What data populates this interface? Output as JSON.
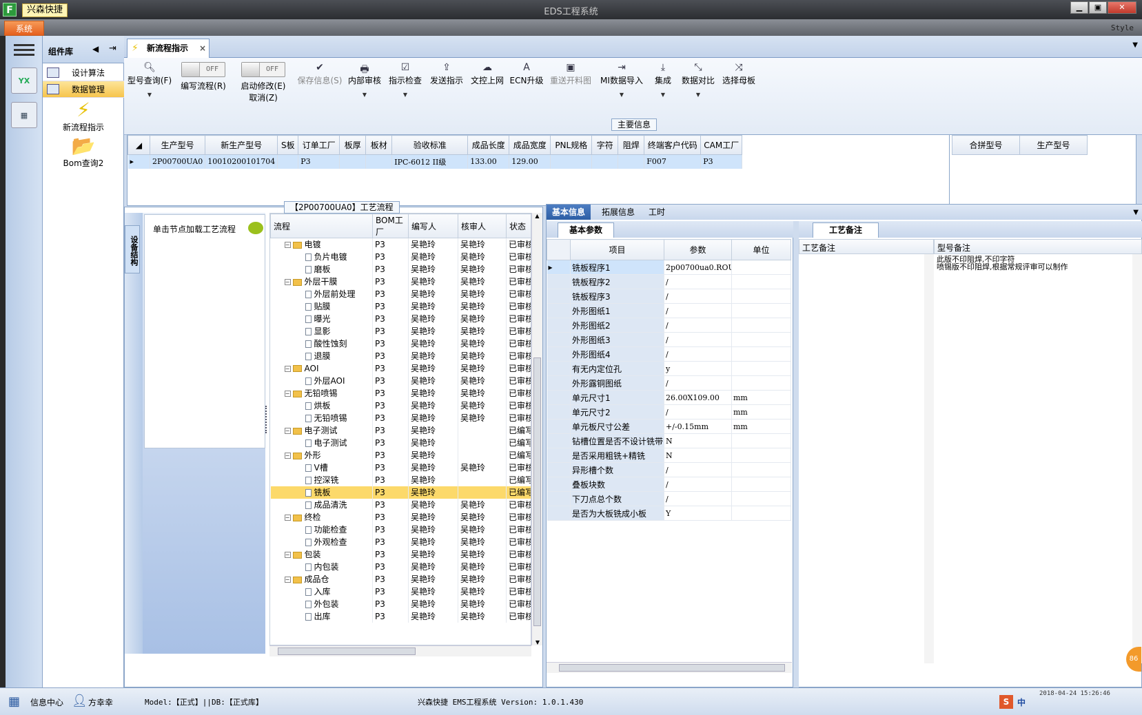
{
  "window": {
    "app_tag": "兴森快捷",
    "title": "EDS工程系统",
    "app_icon": "F"
  },
  "menu": {
    "system_label": "系统",
    "style_label": "Style"
  },
  "icon_bar": {
    "yx_label": "YX"
  },
  "component_library": {
    "title": "组件库",
    "items": [
      {
        "label": "设计算法",
        "selected": false
      },
      {
        "label": "数据管理",
        "selected": true
      }
    ],
    "tools": [
      {
        "label": "新流程指示",
        "icon": "lightning-icon"
      },
      {
        "label": "Bom查询2",
        "icon": "folder-open-icon"
      }
    ]
  },
  "doc_tab": {
    "label": "新流程指示",
    "close": "×"
  },
  "ribbon": {
    "query": {
      "label": "型号查询(F)"
    },
    "edit_flow": {
      "label": "编写流程(R)",
      "toggle": "OFF"
    },
    "start_modify": {
      "label": "启动修改(E)",
      "label2": "取消(Z)",
      "toggle": "OFF"
    },
    "buttons": [
      {
        "label": "保存信息(S)",
        "icon": "✔",
        "disabled": true,
        "dropdown": false
      },
      {
        "label": "内部审核",
        "icon": "🖶",
        "disabled": false,
        "dropdown": true
      },
      {
        "label": "指示检查",
        "icon": "☑",
        "disabled": false,
        "dropdown": true
      },
      {
        "label": "发送指示",
        "icon": "⇪",
        "disabled": false,
        "dropdown": false
      },
      {
        "label": "文控上网",
        "icon": "☁",
        "disabled": false,
        "dropdown": false
      },
      {
        "label": "ECN升级",
        "icon": "A",
        "disabled": false,
        "dropdown": false
      },
      {
        "label": "重送开料图",
        "icon": "▣",
        "disabled": true,
        "dropdown": false
      },
      {
        "label": "MI数据导入",
        "icon": "⇥",
        "disabled": false,
        "dropdown": true
      },
      {
        "label": "集成",
        "icon": "⤓",
        "disabled": false,
        "dropdown": true
      },
      {
        "label": "数据对比",
        "icon": "⤡",
        "disabled": false,
        "dropdown": true
      },
      {
        "label": "选择母板",
        "icon": "⤨",
        "disabled": false,
        "dropdown": false
      }
    ]
  },
  "main_info": {
    "label": "主要信息",
    "columns": [
      "生产型号",
      "新生产型号",
      "S板",
      "订单工厂",
      "板厚",
      "板材",
      "验收标准",
      "成品长度",
      "成品宽度",
      "PNL规格",
      "字符",
      "阻焊",
      "终端客户代码",
      "CAM工厂"
    ],
    "rows": [
      [
        "2P00700UA0",
        "10010200101704",
        "",
        "P3",
        "",
        "",
        "IPC-6012 II级",
        "133.00",
        "129.00",
        "",
        "",
        "",
        "F007",
        "P3"
      ]
    ],
    "side_columns": [
      "合拼型号",
      "生产型号"
    ]
  },
  "flow_panel": {
    "title": "【2P00700UA0】工艺流程",
    "side_tab": "设备结构",
    "hint": "单击节点加载工艺流程",
    "columns": [
      "流程",
      "BOM工厂",
      "编写人",
      "核审人",
      "状态"
    ],
    "rows": [
      {
        "name": "电镀",
        "type": "folder",
        "factory": "P3",
        "writer": "吴艳玲",
        "checker": "吴艳玲",
        "status": "已审核"
      },
      {
        "name": "负片电镀",
        "type": "leaf",
        "factory": "P3",
        "writer": "吴艳玲",
        "checker": "吴艳玲",
        "status": "已审核"
      },
      {
        "name": "磨板",
        "type": "leaf",
        "factory": "P3",
        "writer": "吴艳玲",
        "checker": "吴艳玲",
        "status": "已审核"
      },
      {
        "name": "外层干膜",
        "type": "folder",
        "factory": "P3",
        "writer": "吴艳玲",
        "checker": "吴艳玲",
        "status": "已审核"
      },
      {
        "name": "外层前处理",
        "type": "leaf",
        "factory": "P3",
        "writer": "吴艳玲",
        "checker": "吴艳玲",
        "status": "已审核"
      },
      {
        "name": "贴膜",
        "type": "leaf",
        "factory": "P3",
        "writer": "吴艳玲",
        "checker": "吴艳玲",
        "status": "已审核"
      },
      {
        "name": "曝光",
        "type": "leaf",
        "factory": "P3",
        "writer": "吴艳玲",
        "checker": "吴艳玲",
        "status": "已审核"
      },
      {
        "name": "显影",
        "type": "leaf",
        "factory": "P3",
        "writer": "吴艳玲",
        "checker": "吴艳玲",
        "status": "已审核"
      },
      {
        "name": "酸性蚀刻",
        "type": "leaf",
        "factory": "P3",
        "writer": "吴艳玲",
        "checker": "吴艳玲",
        "status": "已审核"
      },
      {
        "name": "退膜",
        "type": "leaf",
        "factory": "P3",
        "writer": "吴艳玲",
        "checker": "吴艳玲",
        "status": "已审核"
      },
      {
        "name": "AOI",
        "type": "folder",
        "factory": "P3",
        "writer": "吴艳玲",
        "checker": "吴艳玲",
        "status": "已审核"
      },
      {
        "name": "外层AOI",
        "type": "leaf",
        "factory": "P3",
        "writer": "吴艳玲",
        "checker": "吴艳玲",
        "status": "已审核"
      },
      {
        "name": "无铅喷锡",
        "type": "folder",
        "factory": "P3",
        "writer": "吴艳玲",
        "checker": "吴艳玲",
        "status": "已审核"
      },
      {
        "name": "烘板",
        "type": "leaf",
        "factory": "P3",
        "writer": "吴艳玲",
        "checker": "吴艳玲",
        "status": "已审核"
      },
      {
        "name": "无铅喷锡",
        "type": "leaf",
        "factory": "P3",
        "writer": "吴艳玲",
        "checker": "吴艳玲",
        "status": "已审核"
      },
      {
        "name": "电子测试",
        "type": "folder",
        "factory": "P3",
        "writer": "吴艳玲",
        "checker": "",
        "status": "已编写"
      },
      {
        "name": "电子测试",
        "type": "leaf",
        "factory": "P3",
        "writer": "吴艳玲",
        "checker": "",
        "status": "已编写"
      },
      {
        "name": "外形",
        "type": "folder",
        "factory": "P3",
        "writer": "吴艳玲",
        "checker": "",
        "status": "已编写"
      },
      {
        "name": "V槽",
        "type": "leaf",
        "factory": "P3",
        "writer": "吴艳玲",
        "checker": "吴艳玲",
        "status": "已审核"
      },
      {
        "name": "控深铣",
        "type": "leaf",
        "factory": "P3",
        "writer": "吴艳玲",
        "checker": "",
        "status": "已编写"
      },
      {
        "name": "铣板",
        "type": "leaf",
        "factory": "P3",
        "writer": "吴艳玲",
        "checker": "",
        "status": "已编写",
        "highlight": true
      },
      {
        "name": "成品清洗",
        "type": "leaf",
        "factory": "P3",
        "writer": "吴艳玲",
        "checker": "吴艳玲",
        "status": "已审核"
      },
      {
        "name": "终检",
        "type": "folder",
        "factory": "P3",
        "writer": "吴艳玲",
        "checker": "吴艳玲",
        "status": "已审核"
      },
      {
        "name": "功能检查",
        "type": "leaf",
        "factory": "P3",
        "writer": "吴艳玲",
        "checker": "吴艳玲",
        "status": "已审核"
      },
      {
        "name": "外观检查",
        "type": "leaf",
        "factory": "P3",
        "writer": "吴艳玲",
        "checker": "吴艳玲",
        "status": "已审核"
      },
      {
        "name": "包装",
        "type": "folder",
        "factory": "P3",
        "writer": "吴艳玲",
        "checker": "吴艳玲",
        "status": "已审核"
      },
      {
        "name": "内包装",
        "type": "leaf",
        "factory": "P3",
        "writer": "吴艳玲",
        "checker": "吴艳玲",
        "status": "已审核"
      },
      {
        "name": "成品仓",
        "type": "folder",
        "factory": "P3",
        "writer": "吴艳玲",
        "checker": "吴艳玲",
        "status": "已审核"
      },
      {
        "name": "入库",
        "type": "leaf",
        "factory": "P3",
        "writer": "吴艳玲",
        "checker": "吴艳玲",
        "status": "已审核"
      },
      {
        "name": "外包装",
        "type": "leaf",
        "factory": "P3",
        "writer": "吴艳玲",
        "checker": "吴艳玲",
        "status": "已审核"
      },
      {
        "name": "出库",
        "type": "leaf",
        "factory": "P3",
        "writer": "吴艳玲",
        "checker": "吴艳玲",
        "status": "已审核"
      }
    ]
  },
  "detail_tabs": [
    "基本信息",
    "拓展信息",
    "工时"
  ],
  "basic_params": {
    "title": "基本参数",
    "columns": [
      "项目",
      "参数",
      "单位"
    ],
    "rows": [
      {
        "item": "铣板程序1",
        "value": "2p00700ua0.ROU",
        "unit": ""
      },
      {
        "item": "铣板程序2",
        "value": "/",
        "unit": ""
      },
      {
        "item": "铣板程序3",
        "value": "/",
        "unit": ""
      },
      {
        "item": "外形图纸1",
        "value": "/",
        "unit": ""
      },
      {
        "item": "外形图纸2",
        "value": "/",
        "unit": ""
      },
      {
        "item": "外形图纸3",
        "value": "/",
        "unit": ""
      },
      {
        "item": "外形图纸4",
        "value": "/",
        "unit": ""
      },
      {
        "item": "有无内定位孔",
        "value": "y",
        "unit": ""
      },
      {
        "item": "外形露铜图纸",
        "value": "/",
        "unit": ""
      },
      {
        "item": "单元尺寸1",
        "value": "26.00X109.00",
        "unit": "mm"
      },
      {
        "item": "单元尺寸2",
        "value": "/",
        "unit": "mm"
      },
      {
        "item": "单元板尺寸公差",
        "value": "+/-0.15mm",
        "unit": "mm"
      },
      {
        "item": "钻槽位置是否不设计铣带",
        "value": "N",
        "unit": ""
      },
      {
        "item": "是否采用粗铣+精铣",
        "value": "N",
        "unit": ""
      },
      {
        "item": "异形槽个数",
        "value": "/",
        "unit": ""
      },
      {
        "item": "叠板块数",
        "value": "/",
        "unit": ""
      },
      {
        "item": "下刀点总个数",
        "value": "/",
        "unit": ""
      },
      {
        "item": "是否为大板铣成小板",
        "value": "Y",
        "unit": ""
      }
    ]
  },
  "process_notes": {
    "title": "工艺备注",
    "columns": [
      "工艺备注",
      "型号备注"
    ],
    "model_note": "此版不印阻焊,不印字符\n喷锡版不印阻焊,根据常规评审可以制作"
  },
  "statusbar": {
    "info_center": "信息中心",
    "user": "方幸幸",
    "model_db": "Model:【正式】||DB:【正式库】",
    "version": "兴森快捷 EMS工程系统 Version: 1.0.1.430",
    "ime": "中",
    "datetime": "2018-04-24 15:26:46",
    "badge": "86"
  }
}
